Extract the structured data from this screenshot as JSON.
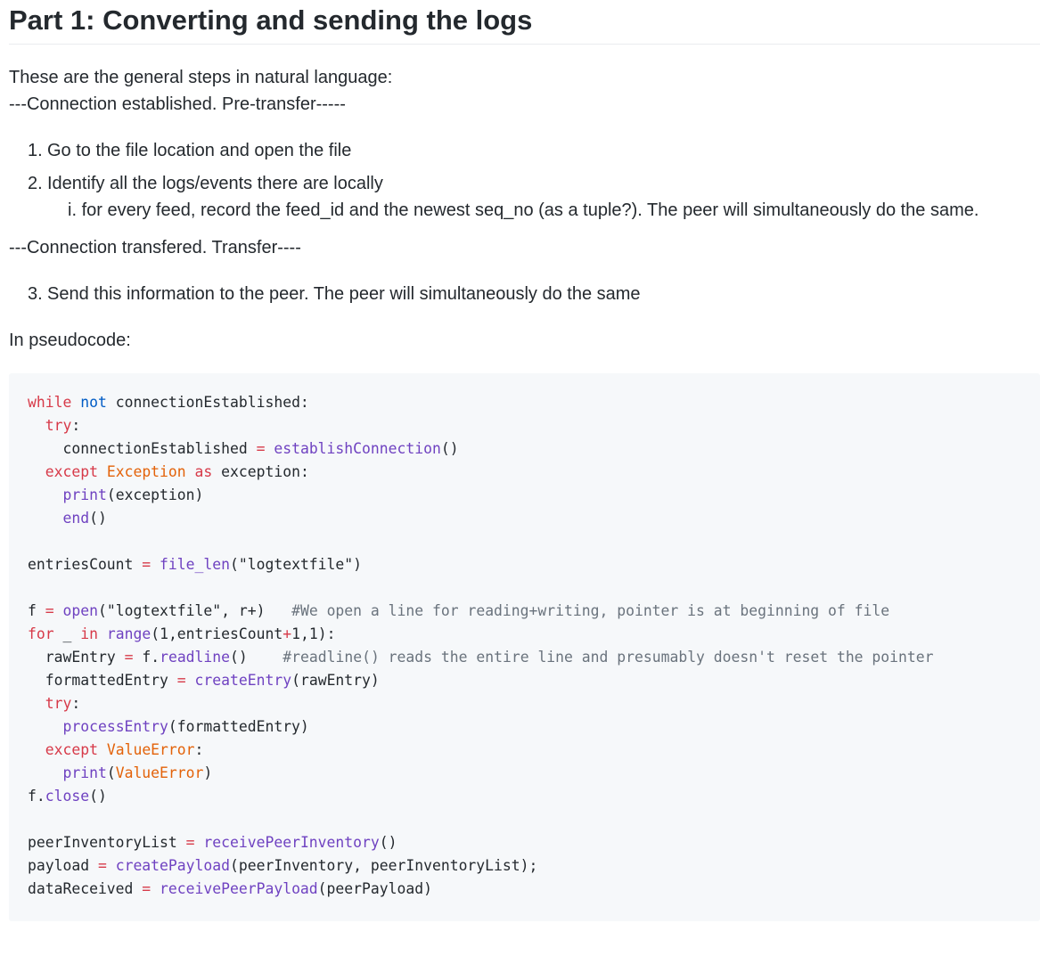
{
  "heading": "Part 1: Converting and sending the logs",
  "intro": "These are the general steps in natural language:",
  "pretransfer_label": "---Connection established. Pre-transfer-----",
  "steps": [
    {
      "number": "1.",
      "text": "Go to the file location and open the file"
    },
    {
      "number": "2.",
      "text": "Identify all the logs/events there are locally"
    }
  ],
  "substeps": [
    {
      "number": "i.",
      "text": "for every feed, record the feed_id and the newest seq_no (as a tuple?). The peer will simultaneously do the same."
    }
  ],
  "transfer_label": "---Connection transfered. Transfer----",
  "steps2": [
    {
      "number": "3.",
      "text": "Send this information to the peer. The peer will simultaneously do the same"
    }
  ],
  "pseudocode_label": "In pseudocode:",
  "code": {
    "l1": [
      "while",
      "not",
      "connectionEstablished:"
    ],
    "l2": [
      "try",
      ":"
    ],
    "l3": [
      "connectionEstablished",
      "=",
      "establishConnection",
      "()"
    ],
    "l4": [
      "except",
      "Exception",
      "as",
      "exception:"
    ],
    "l5": [
      "print",
      "(exception)"
    ],
    "l6": [
      "end",
      "()"
    ],
    "l8": [
      "entriesCount",
      "=",
      "file_len",
      "(\"logtextfile\")"
    ],
    "l10": [
      "f",
      "=",
      "open",
      "(\"logtextfile\", r+)",
      "#We open a line for reading+writing, pointer is at beginning of file"
    ],
    "l11": [
      "for",
      "_",
      "in",
      "range",
      "(1,entriesCount",
      "+",
      "1,1):"
    ],
    "l12": [
      "rawEntry",
      "=",
      "f.",
      "readline",
      "()",
      "#readline() reads the entire line and presumably doesn't reset the pointer"
    ],
    "l13": [
      "formattedEntry",
      "=",
      "createEntry",
      "(rawEntry)"
    ],
    "l14": [
      "try",
      ":"
    ],
    "l15": [
      "processEntry",
      "(formattedEntry)"
    ],
    "l16": [
      "except",
      "ValueError",
      ":"
    ],
    "l17": [
      "print",
      "(",
      "ValueError",
      ")"
    ],
    "l18": [
      "f.",
      "close",
      "()"
    ],
    "l20": [
      "peerInventoryList",
      "=",
      "receivePeerInventory",
      "()"
    ],
    "l21": [
      "payload",
      "=",
      "createPayload",
      "(peerInventory, peerInventoryList);"
    ],
    "l22": [
      "dataReceived",
      "=",
      "receivePeerPayload",
      "(peerPayload)"
    ]
  }
}
